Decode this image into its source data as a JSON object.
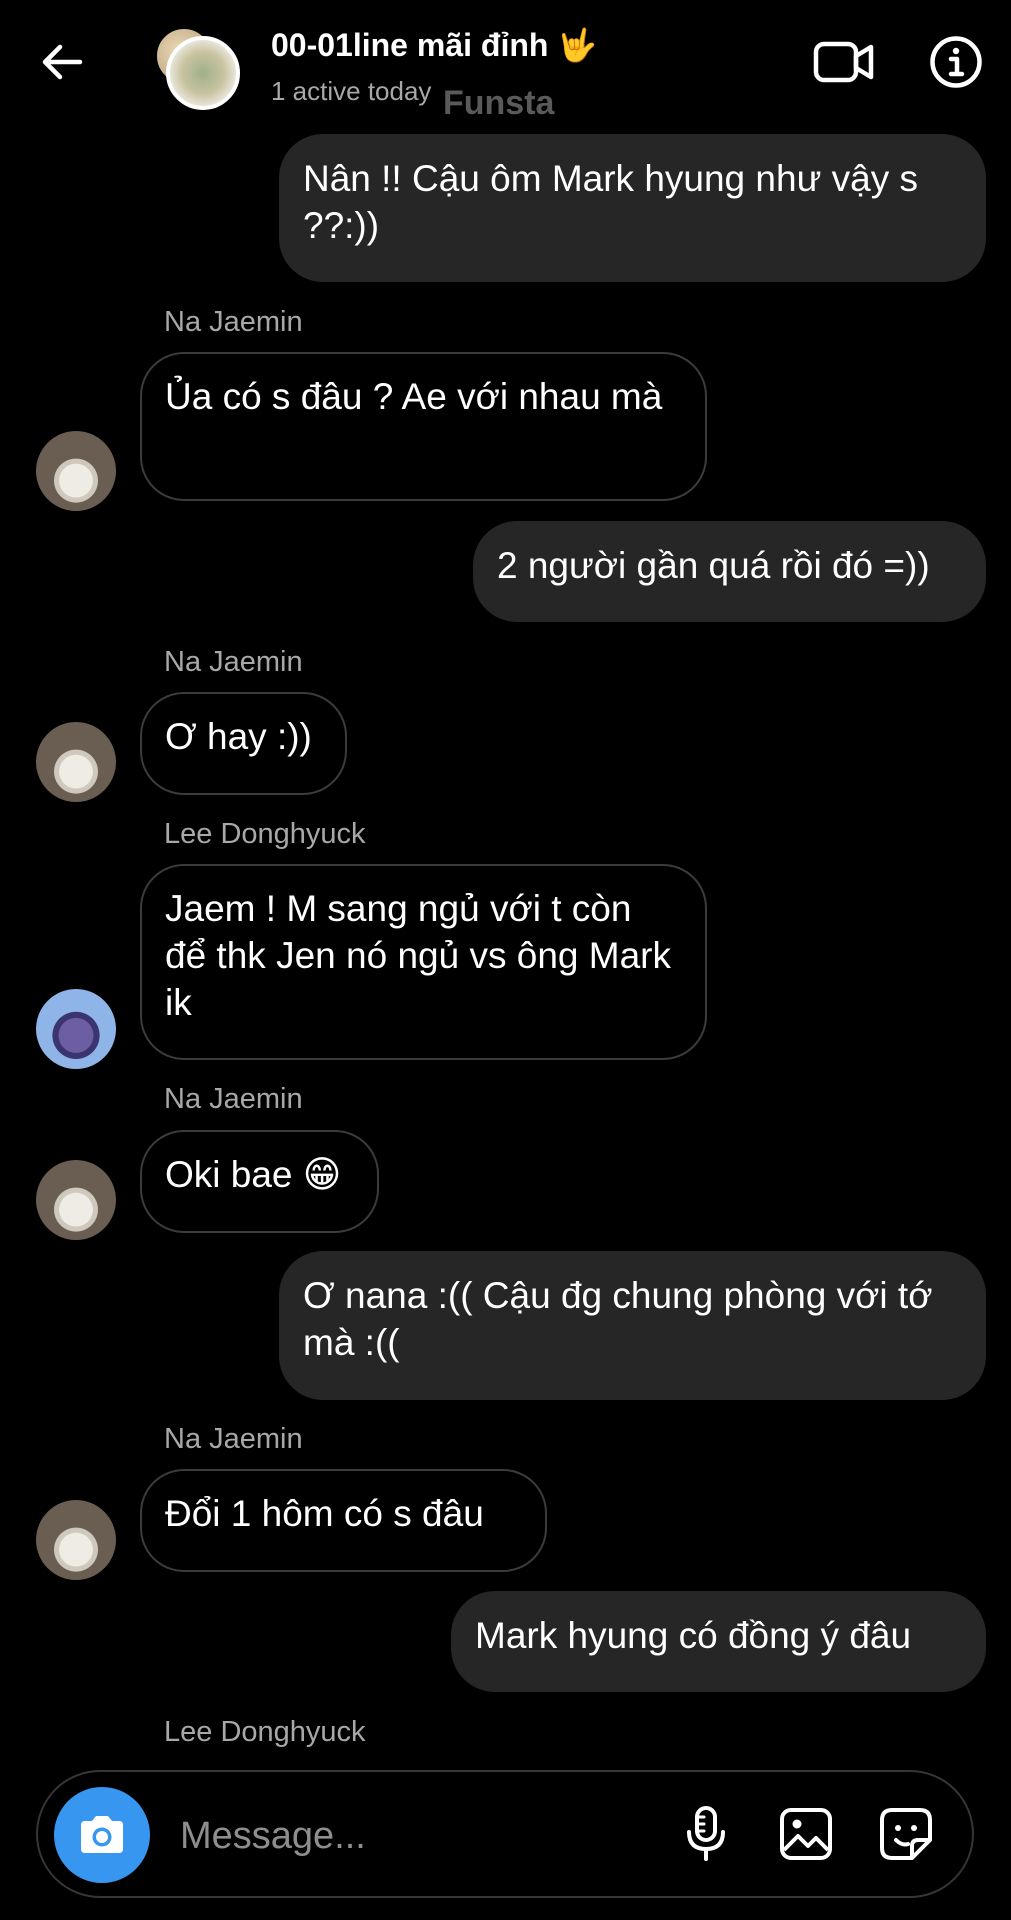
{
  "header": {
    "title": "00-01line mãi đỉnh 🤟",
    "subtitle": "1 active today",
    "watermark": "Funsta"
  },
  "messages": [
    {
      "direction": "outgoing",
      "text": "Nân !! Cậu ôm Mark hyung như vậy s ??:))"
    },
    {
      "direction": "incoming",
      "sender": "Na Jaemin",
      "text": "Ủa có s đâu ? Ae với nhau mà"
    },
    {
      "direction": "outgoing",
      "text": "2 người gần quá rồi đó =))"
    },
    {
      "direction": "incoming",
      "sender": "Na Jaemin",
      "text": "Ơ hay :))"
    },
    {
      "direction": "incoming",
      "sender": "Lee Donghyuck",
      "text": "Jaem ! M sang ngủ với t còn để thk Jen nó ngủ vs ông Mark ik"
    },
    {
      "direction": "incoming",
      "sender": "Na Jaemin",
      "text": "Oki bae 😁"
    },
    {
      "direction": "outgoing",
      "text": "Ơ nana :(( Cậu đg chung phòng với tớ mà :(("
    },
    {
      "direction": "incoming",
      "sender": "Na Jaemin",
      "text": "Đổi 1 hôm có s đâu"
    },
    {
      "direction": "outgoing",
      "text": "Mark hyung có đồng ý đâu"
    }
  ],
  "typing_sender": "Lee Donghyuck",
  "composer": {
    "placeholder": "Message..."
  },
  "icons": {
    "back": "arrow-left-icon",
    "video": "video-camera-icon",
    "info": "info-icon",
    "camera": "camera-icon",
    "mic": "microphone-icon",
    "gallery": "image-icon",
    "sticker": "sticker-icon"
  },
  "colors": {
    "background": "#000000",
    "outgoing_bubble": "#262626",
    "incoming_border": "#3c3c3c",
    "secondary_text": "#a8a8a8",
    "camera_button": "#3797f0"
  }
}
